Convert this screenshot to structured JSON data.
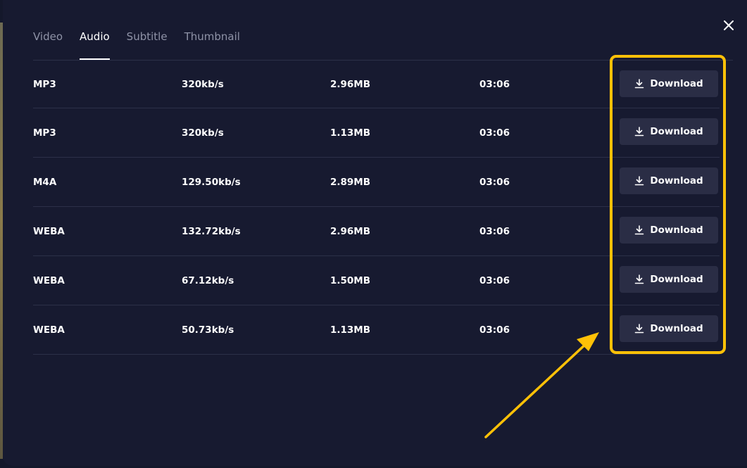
{
  "tabs": [
    {
      "label": "Video",
      "active": false
    },
    {
      "label": "Audio",
      "active": true
    },
    {
      "label": "Subtitle",
      "active": false
    },
    {
      "label": "Thumbnail",
      "active": false
    }
  ],
  "close_icon": "close-icon",
  "download_icon": "download-icon",
  "rows": [
    {
      "format": "MP3",
      "bitrate": "320kb/s",
      "size": "2.96MB",
      "duration": "03:06",
      "button_label": "Download"
    },
    {
      "format": "MP3",
      "bitrate": "320kb/s",
      "size": "1.13MB",
      "duration": "03:06",
      "button_label": "Download"
    },
    {
      "format": "M4A",
      "bitrate": "129.50kb/s",
      "size": "2.89MB",
      "duration": "03:06",
      "button_label": "Download"
    },
    {
      "format": "WEBA",
      "bitrate": "132.72kb/s",
      "size": "2.96MB",
      "duration": "03:06",
      "button_label": "Download"
    },
    {
      "format": "WEBA",
      "bitrate": "67.12kb/s",
      "size": "1.50MB",
      "duration": "03:06",
      "button_label": "Download"
    },
    {
      "format": "WEBA",
      "bitrate": "50.73kb/s",
      "size": "1.13MB",
      "duration": "03:06",
      "button_label": "Download"
    }
  ],
  "colors": {
    "background": "#171a30",
    "button": "#2a2d45",
    "highlight": "#ffc107",
    "text": "#ffffff",
    "muted_text": "#8f93a7"
  }
}
